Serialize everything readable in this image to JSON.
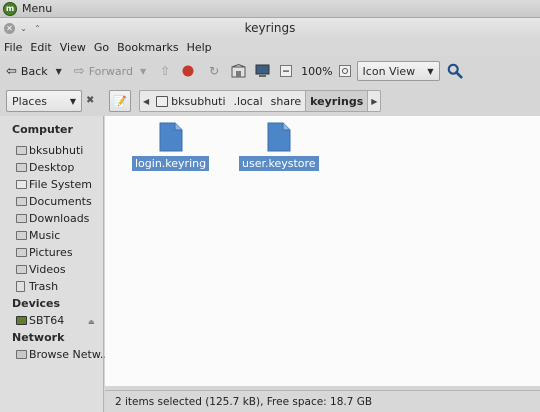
{
  "panel": {
    "menu_label": "Menu"
  },
  "window": {
    "title": "keyrings"
  },
  "menubar": {
    "items": [
      "File",
      "Edit",
      "View",
      "Go",
      "Bookmarks",
      "Help"
    ]
  },
  "toolbar": {
    "back_label": "Back",
    "forward_label": "Forward",
    "zoom": "100%",
    "view_mode": "Icon View"
  },
  "sidebar_selector": {
    "label": "Places"
  },
  "breadcrumb": {
    "items": [
      "bksubhuti",
      ".local",
      "share",
      "keyrings"
    ]
  },
  "sidebar": {
    "computer_header": "Computer",
    "computer_items": [
      "bksubhuti",
      "Desktop",
      "File System",
      "Documents",
      "Downloads",
      "Music",
      "Pictures",
      "Videos",
      "Trash"
    ],
    "devices_header": "Devices",
    "device_items": [
      "SBT64"
    ],
    "network_header": "Network",
    "network_items": [
      "Browse Netw..."
    ]
  },
  "files": [
    {
      "name": "login.keyring",
      "selected": true
    },
    {
      "name": "user.keystore",
      "selected": true
    }
  ],
  "statusbar": {
    "text": "2 items selected (125.7 kB), Free space: 18.7 GB"
  },
  "colors": {
    "selection": "#5b8cc5",
    "file_icon": "#4d86c8"
  }
}
